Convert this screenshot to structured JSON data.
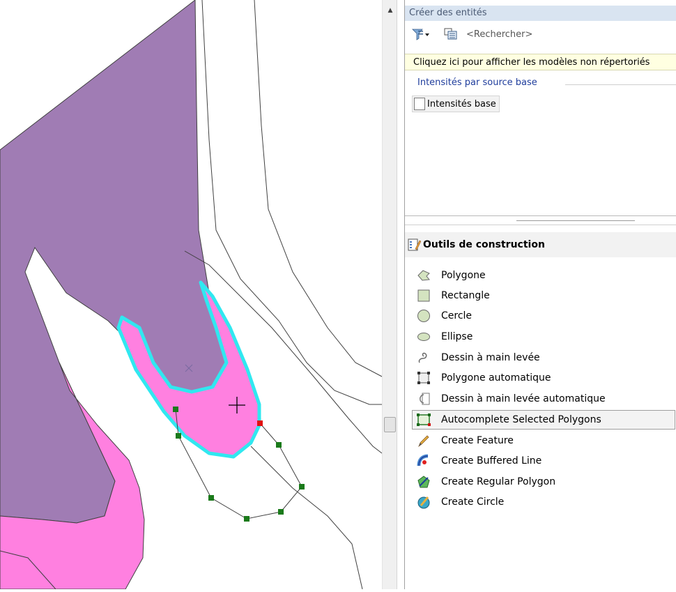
{
  "panel": {
    "title": "Créer des entités",
    "search_placeholder": "<Rechercher>",
    "info_banner": "Cliquez ici pour afficher les modèles non répertoriés",
    "group_header": "Intensités par source base",
    "template_label": "Intensités base"
  },
  "tools": {
    "header": "Outils de construction",
    "items": [
      {
        "label": "Polygone",
        "icon": "polygon-icon"
      },
      {
        "label": "Rectangle",
        "icon": "rectangle-icon"
      },
      {
        "label": "Cercle",
        "icon": "circle-icon"
      },
      {
        "label": "Ellipse",
        "icon": "ellipse-icon"
      },
      {
        "label": "Dessin à main levée",
        "icon": "freehand-icon"
      },
      {
        "label": "Polygone automatique",
        "icon": "auto-polygon-icon"
      },
      {
        "label": "Dessin à main levée automatique",
        "icon": "auto-freehand-icon"
      },
      {
        "label": "Autocomplete Selected Polygons",
        "icon": "autocomplete-icon",
        "selected": true
      },
      {
        "label": "Create Feature",
        "icon": "pencil-icon"
      },
      {
        "label": "Create Buffered Line",
        "icon": "buffered-line-icon"
      },
      {
        "label": "Create Regular Polygon",
        "icon": "regular-polygon-icon"
      },
      {
        "label": "Create Circle",
        "icon": "create-circle-icon"
      }
    ]
  },
  "colors": {
    "purple_fill": "#a07cb4",
    "pink_fill": "#ff80e0",
    "cyan_outline": "#30e8f0",
    "vertex_green": "#1a7a1a",
    "vertex_red": "#e01010",
    "panel_title_bg": "#d9e4f1",
    "banner_bg": "#ffffe1"
  }
}
